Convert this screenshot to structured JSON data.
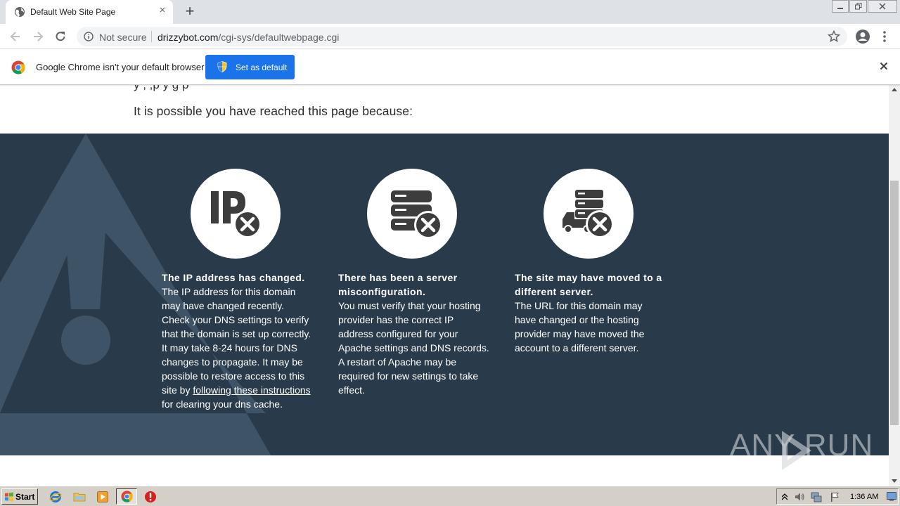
{
  "browser": {
    "tab": {
      "title": "Default Web Site Page",
      "close": "×"
    },
    "new_tab": "+",
    "address": {
      "security_label": "Not secure",
      "domain": "drizzybot.com",
      "path": "/cgi-sys/defaultwebpage.cgi"
    }
  },
  "infobar": {
    "message": "Google Chrome isn't your default browser",
    "button_label": "Set as default"
  },
  "page": {
    "cut_off_line": "y                              ,                        ,p                  y               g p",
    "reason_heading": "It is possible you have reached this page because:",
    "reasons": [
      {
        "icon": "ip-error-icon",
        "title": "The IP address has changed.",
        "body_before": "The IP address for this domain may have changed recently. Check your DNS settings to verify that the domain is set up correctly. It may take 8-24 hours for DNS changes to propagate. It may be possible to restore access to this site by ",
        "link": "following these instructions",
        "body_after": " for clearing your dns cache."
      },
      {
        "icon": "server-error-icon",
        "title": "There has been a server misconfiguration.",
        "body_before": "You must verify that your hosting provider has the correct IP address configured for your Apache settings and DNS records. A restart of Apache may be required for new settings to take effect.",
        "link": "",
        "body_after": ""
      },
      {
        "icon": "server-moved-icon",
        "title": "The site may have moved to a different server.",
        "body_before": "The URL for this domain may have changed or the hosting provider may have moved the account to a different server.",
        "link": "",
        "body_after": ""
      }
    ]
  },
  "watermark": "ANY  RUN",
  "taskbar": {
    "start_label": "Start",
    "clock": "1:36 AM"
  },
  "colors": {
    "dark_band": "#293a4a",
    "button_blue": "#1a73e8",
    "warning_shape": "#3f5366"
  }
}
